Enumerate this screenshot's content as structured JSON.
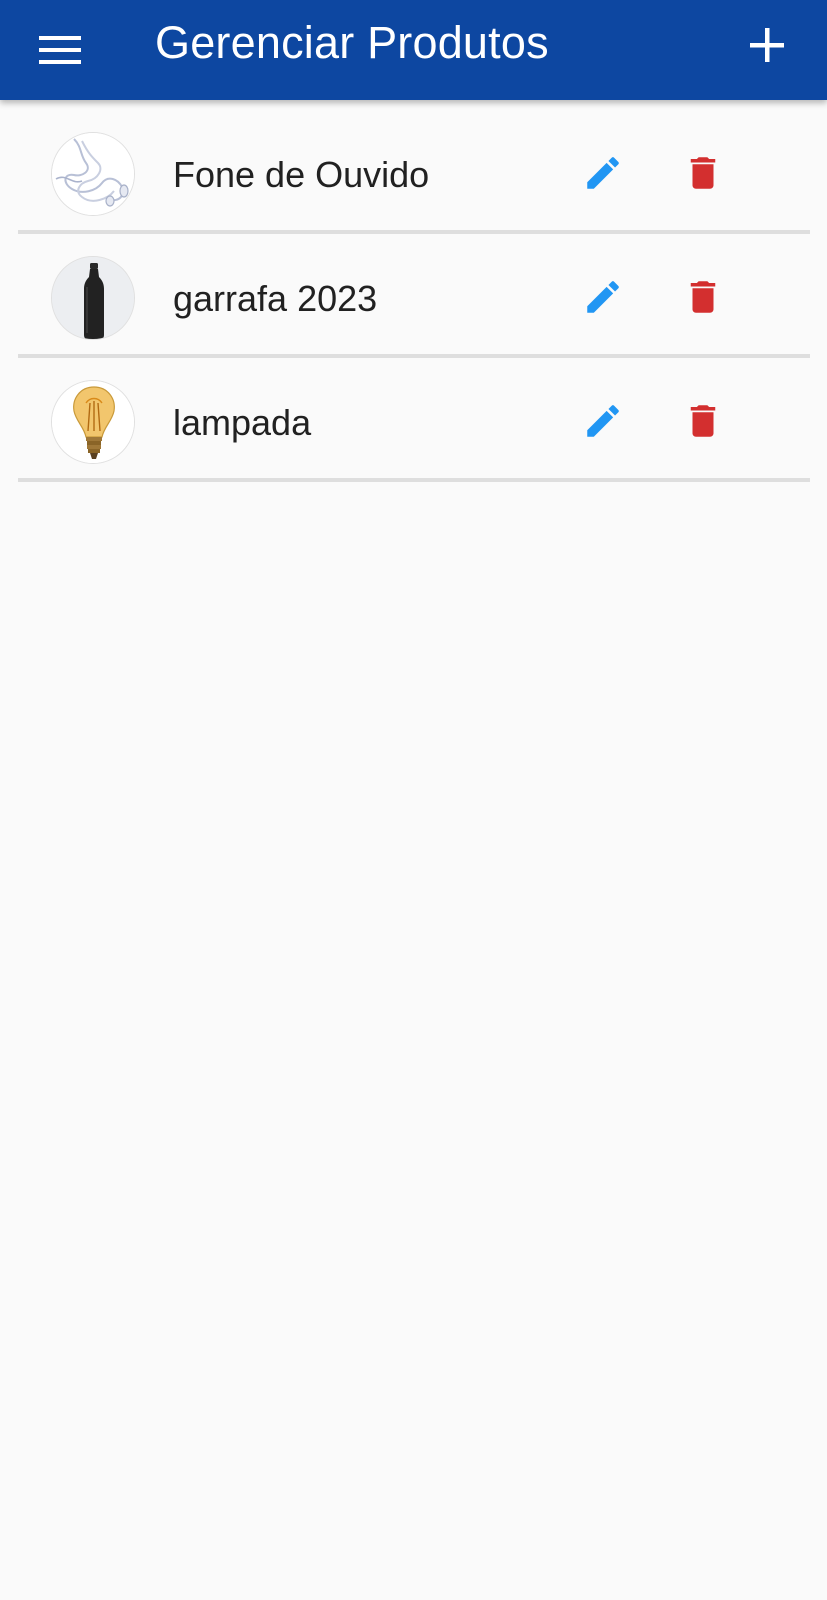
{
  "appbar": {
    "title": "Gerenciar Produtos",
    "background_color": "#0d47a1",
    "menu_icon": "menu-icon",
    "add_icon": "plus-icon"
  },
  "products": [
    {
      "name": "Fone de Ouvido",
      "image": "earphones-thumbnail"
    },
    {
      "name": "garrafa 2023",
      "image": "bottle-thumbnail"
    },
    {
      "name": "lampada",
      "image": "lightbulb-thumbnail"
    }
  ],
  "actions": {
    "edit_icon": "pencil-icon",
    "edit_color": "#2196f3",
    "delete_icon": "trash-icon",
    "delete_color": "#d32f2f"
  }
}
